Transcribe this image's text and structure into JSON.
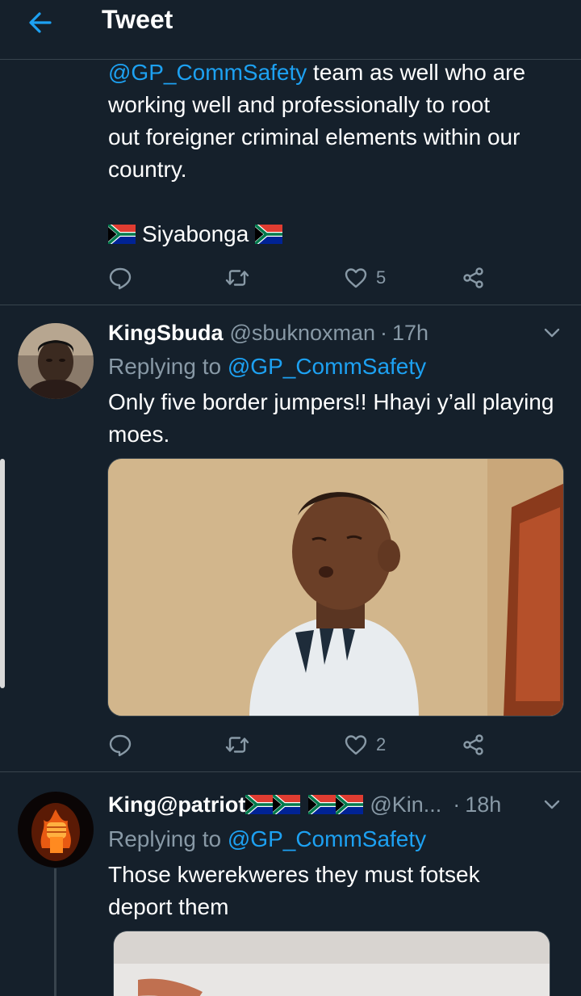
{
  "header": {
    "title": "Tweet",
    "back_icon": "arrow-left-icon"
  },
  "tweet1": {
    "body_mention": "@GP_CommSafety",
    "body_text_1": " team as well who are",
    "body_text_2": "working well and professionally to root",
    "body_text_3": "out foreigner criminal elements within our",
    "body_text_4": "country.",
    "signoff": "Siyabonga",
    "likes": "5"
  },
  "tweet2": {
    "name": "KingSbuda",
    "handle": "@sbuknoxman",
    "time": "17h",
    "replying_label": "Replying to ",
    "replying_to": "@GP_CommSafety",
    "body": "Only five border jumpers!! Hhayi y’all playing moes.",
    "likes": "2"
  },
  "tweet3": {
    "name": "King@patriot",
    "handle": "@Kin...",
    "time": "18h",
    "replying_label": "Replying to ",
    "replying_to": "@GP_CommSafety",
    "body": "Those kwerekweres they must fotsek deport them"
  },
  "colors": {
    "background": "#15202b",
    "accent": "#1da1f2",
    "muted": "#8899a6",
    "divider": "#38444d"
  }
}
